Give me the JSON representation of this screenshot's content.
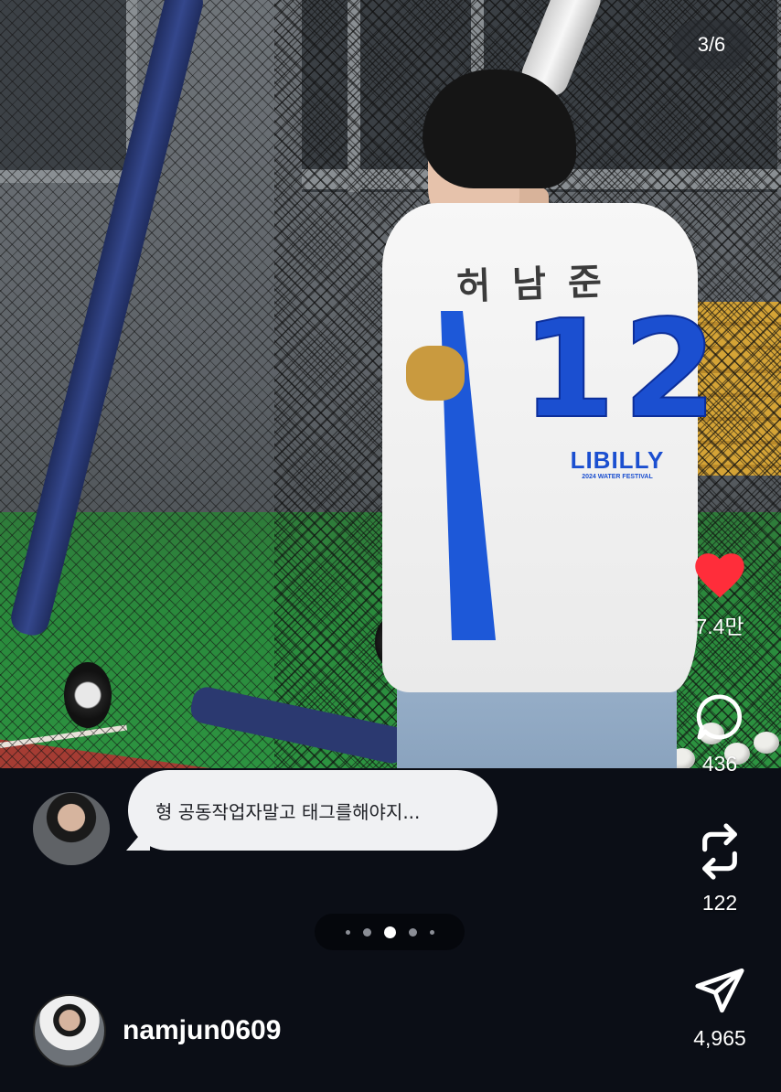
{
  "post": {
    "counter": "3/6",
    "jersey_name": "허남준",
    "jersey_number": "12",
    "jersey_brand": "LIBILLY",
    "jersey_sub": "2024 WATER FESTIVAL"
  },
  "actions": {
    "like": {
      "icon": "heart-icon",
      "count": "7.4만",
      "color": "#ff2d3a"
    },
    "comment": {
      "icon": "comment-bubble-icon",
      "count": "436"
    },
    "repost": {
      "icon": "repost-icon",
      "count": "122"
    },
    "share": {
      "icon": "send-icon",
      "count": "4,965"
    }
  },
  "comment": {
    "text": "형 공동작업자말고 태그를해야지..."
  },
  "pagination": {
    "total": 5,
    "active_index": 2
  },
  "profile": {
    "username": "namjun0609"
  }
}
